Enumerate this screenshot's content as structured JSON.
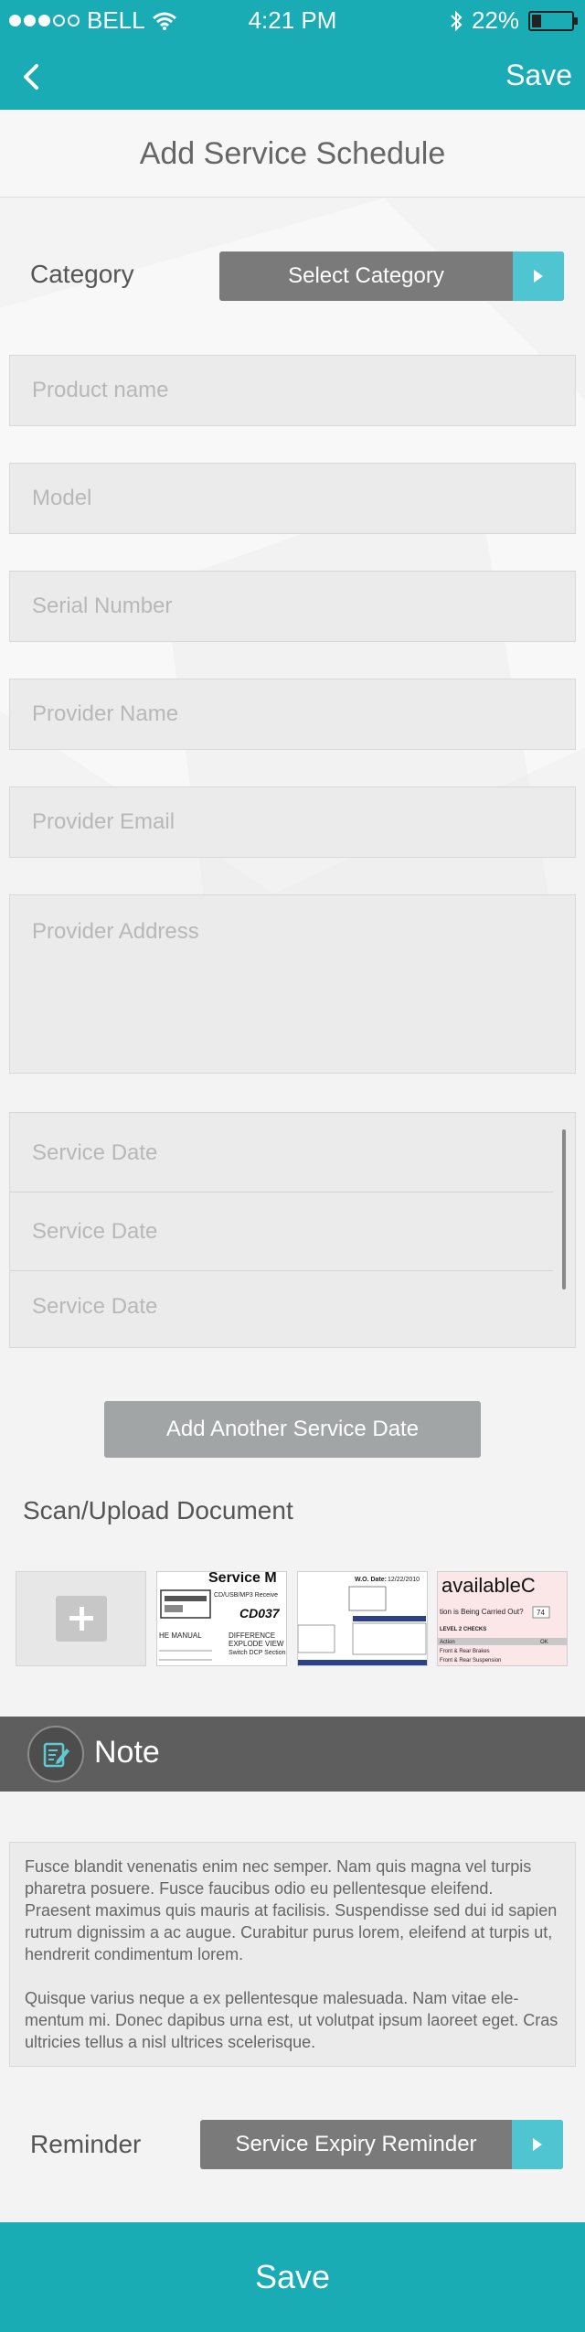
{
  "status_bar": {
    "carrier": "BELL",
    "time": "4:21 PM",
    "battery": "22%",
    "battery_level": 0.22
  },
  "nav": {
    "save_label": "Save"
  },
  "page": {
    "title": "Add Service Schedule"
  },
  "category": {
    "label": "Category",
    "value": "Select Category"
  },
  "fields": {
    "product_name": "Product name",
    "model": "Model",
    "serial_number": "Serial Number",
    "provider_name": "Provider Name",
    "provider_email": "Provider Email",
    "provider_address": "Provider Address"
  },
  "service_dates": [
    "Service Date",
    "Service Date",
    "Service Date"
  ],
  "add_date_label": "Add Another Service Date",
  "scan": {
    "title": "Scan/Upload Document",
    "thumb1": {
      "title": "Service M",
      "line1": "CD/USB/MP3 Receive",
      "model": "CD037",
      "line2": "HE MANUAL",
      "line3": "DIFFERENCE",
      "line4": "EXPLODE VIEW",
      "line5": "Switch DCP Section"
    },
    "thumb2": {
      "date_label": "W.O. Date:",
      "date": "12/22/2010"
    },
    "thumb3": {
      "brand": "availableC",
      "row1": "tion is Being Carried Out?",
      "row1_val": "74",
      "heading": "LEVEL 2 CHECKS",
      "action": "Action",
      "ok": "OK",
      "item1": "Front & Rear Brakes",
      "item2": "Front & Rear Suspension"
    }
  },
  "note": {
    "title": "Note",
    "paragraph1": "Fusce blandit venenatis enim nec semper. Nam quis magna vel turpis pharetra posuere. Fusce faucibus odio eu pellentesque eleifend. Praesent maximus quis mauris at facilisis. Suspendisse sed dui id sapien rutrum dignissim a ac augue. Curabitur purus lorem, eleifend at turpis ut, hendrerit condimentum lorem.",
    "paragraph2": "Quisque varius neque a ex pellentesque malesuada. Nam vitae ele-mentum mi. Donec dapibus urna est, ut volutpat ipsum laoreet eget. Cras ultricies tellus a nisl ultrices scelerisque."
  },
  "reminder": {
    "label": "Reminder",
    "value": "Service Expiry Reminder"
  },
  "bottom_save_label": "Save",
  "colors": {
    "accent": "#1aacb4",
    "arrow_tab": "#4fc5d2",
    "select_bg": "#7a7a7a",
    "note_bar": "#5e5e5e"
  }
}
